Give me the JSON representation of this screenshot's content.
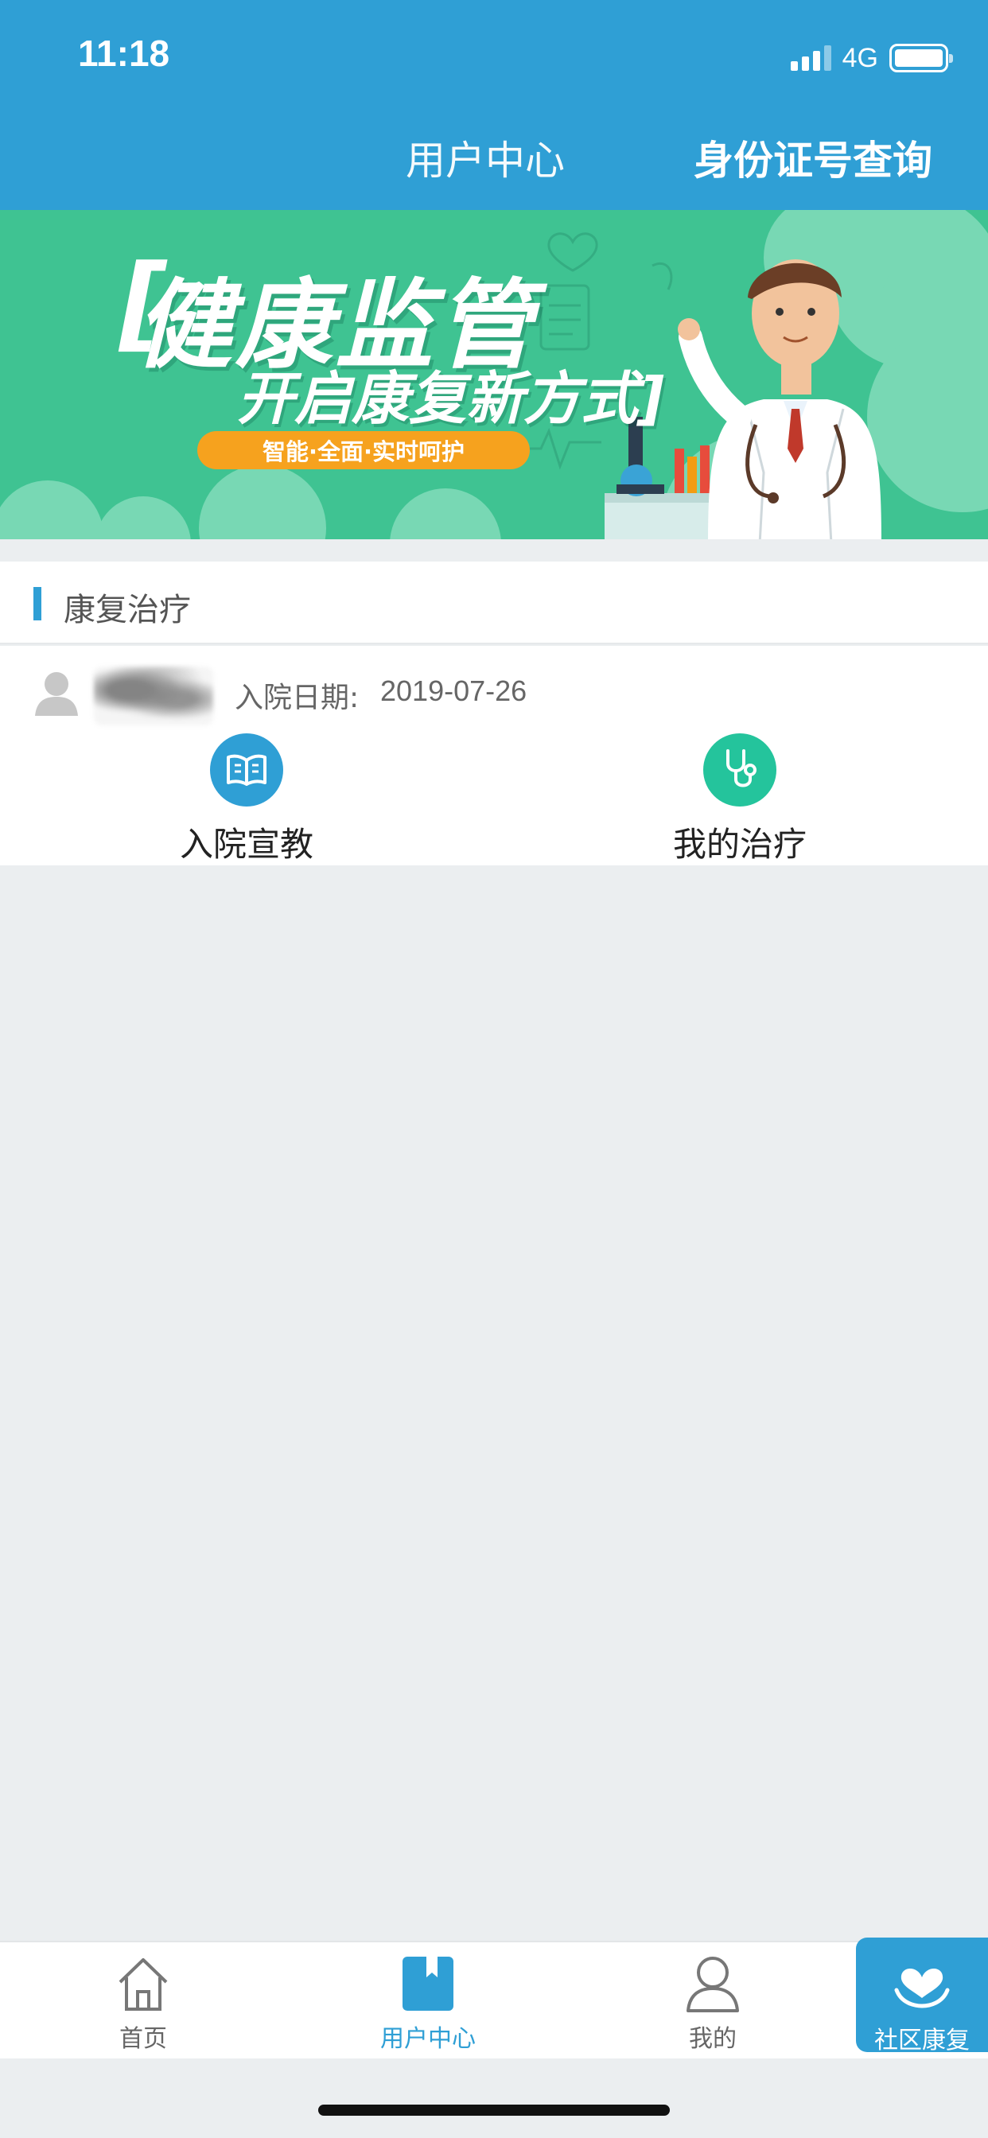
{
  "status_bar": {
    "time": "11:18",
    "network": "4G"
  },
  "header": {
    "tabs": [
      {
        "label": "用户中心"
      },
      {
        "label": "身份证号查询"
      }
    ]
  },
  "banner": {
    "bracket": "[",
    "title": "健康监管",
    "subtitle": "开启康复新方式]",
    "tagline": "智能·全面·实时呵护"
  },
  "section": {
    "title": "康复治疗"
  },
  "record": {
    "admit_label": "入院日期:",
    "admit_date": "2019-07-26",
    "actions": [
      {
        "label": "入院宣教",
        "icon": "book-icon",
        "color": "#2f9fd5"
      },
      {
        "label": "我的治疗",
        "icon": "stethoscope-icon",
        "color": "#24c49c"
      }
    ]
  },
  "tabbar": {
    "items": [
      {
        "label": "首页",
        "icon": "home-icon"
      },
      {
        "label": "用户中心",
        "icon": "bookmark-book-icon",
        "active": true
      },
      {
        "label": "我的",
        "icon": "person-icon"
      },
      {
        "label": "社区康复",
        "icon": "heart-hands-icon"
      }
    ]
  },
  "colors": {
    "primary": "#2f9fd5",
    "accent_green": "#24c49c",
    "banner_green": "#3fc392",
    "tagline_orange": "#f6a21e"
  }
}
